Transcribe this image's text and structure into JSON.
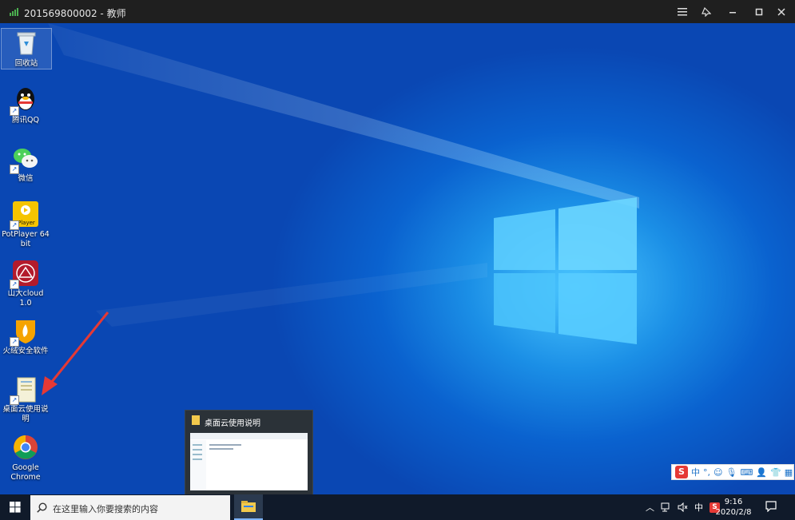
{
  "window": {
    "title": "201569800002 - 教师",
    "controls": [
      "menu-icon",
      "pin-icon",
      "minimize-icon",
      "maximize-icon",
      "close-icon"
    ]
  },
  "desktop_icons": [
    {
      "label": "回收站",
      "icon": "recycle-bin-icon"
    },
    {
      "label": "腾讯QQ",
      "icon": "qq-icon"
    },
    {
      "label": "微信",
      "icon": "wechat-icon"
    },
    {
      "label": "PotPlayer 64 bit",
      "icon": "potplayer-icon",
      "icon_text": "Player"
    },
    {
      "label": "山大cloud 1.0",
      "icon": "sdu-cloud-icon"
    },
    {
      "label": "火绒安全软件",
      "icon": "huorong-icon"
    },
    {
      "label": "桌面云使用说明",
      "icon": "folder-shortcut-icon"
    },
    {
      "label": "Google Chrome",
      "icon": "chrome-icon"
    }
  ],
  "preview": {
    "title": "桌面云使用说明"
  },
  "ime_toolbar": {
    "mode": "中",
    "punct": "°,",
    "items": [
      "smiley-icon",
      "mic-icon",
      "keyboard-icon",
      "person-icon",
      "shirt-icon",
      "grid-icon"
    ]
  },
  "taskbar": {
    "search_placeholder": "在这里输入你要搜索的内容",
    "tray_lang": "中",
    "time": "9:16",
    "date": "2020/2/8"
  },
  "colors": {
    "accent": "#1b8fe6",
    "taskbar": "#101a2a",
    "arrow": "#e53935"
  }
}
